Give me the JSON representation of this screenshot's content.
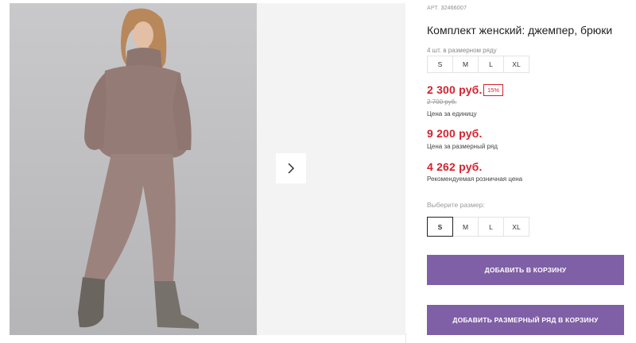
{
  "product": {
    "article_label": "АРТ.",
    "article_number": "32466007",
    "title": "Комплект женский: джемпер, брюки",
    "pack_note": "4 шт. в размерном ряду",
    "pack_sizes": [
      "S",
      "M",
      "L",
      "XL"
    ]
  },
  "pricing": {
    "unit_price": "2 300 руб.",
    "discount": "15%",
    "old_price": "2 700 руб.",
    "unit_caption": "Цена за единицу",
    "pack_price": "9 200 руб.",
    "pack_caption": "Цена за размерный ряд",
    "retail_price": "4 262 руб.",
    "retail_caption": "Рекомендуемая розничная цена"
  },
  "size_picker": {
    "label": "Выберите размер:",
    "options": [
      "S",
      "M",
      "L",
      "XL"
    ],
    "selected": "S"
  },
  "actions": {
    "add_to_cart": "ДОБАВИТЬ В КОРЗИНУ",
    "add_pack_to_cart": "ДОБАВИТЬ РАЗМЕРНЫЙ РЯД В КОРЗИНУ"
  },
  "gallery": {
    "next_icon": "chevron-right-icon"
  },
  "colors": {
    "accent_button": "#7f5fa6",
    "price_red": "#d4222e"
  }
}
